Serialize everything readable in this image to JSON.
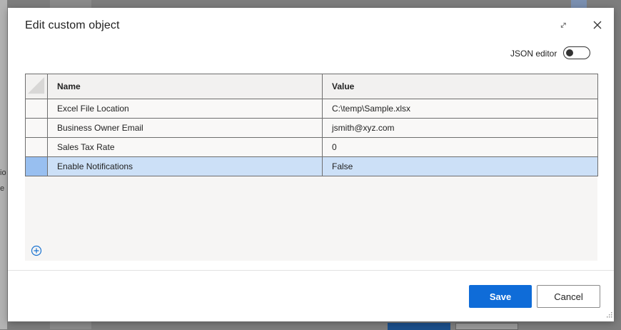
{
  "background": {
    "fragment_1": "io",
    "fragment_2": "e"
  },
  "dialog": {
    "title": "Edit custom object",
    "expand_icon": "expand-icon",
    "close_icon": "close-icon",
    "json_editor_label": "JSON editor",
    "json_editor_on": false
  },
  "grid": {
    "columns": [
      "Name",
      "Value"
    ],
    "rows": [
      {
        "name": "Excel File Location",
        "value": "C:\\temp\\Sample.xlsx",
        "selected": false
      },
      {
        "name": "Business Owner Email",
        "value": "jsmith@xyz.com",
        "selected": false
      },
      {
        "name": "Sales Tax Rate",
        "value": "0",
        "selected": false
      },
      {
        "name": "Enable Notifications",
        "value": "False",
        "selected": true
      }
    ],
    "add_icon": "add-circle-icon"
  },
  "footer": {
    "save_label": "Save",
    "cancel_label": "Cancel"
  },
  "colors": {
    "accent": "#0f6cd8",
    "selected_row": "#cce0f7",
    "selected_row_header": "#98bff0"
  }
}
